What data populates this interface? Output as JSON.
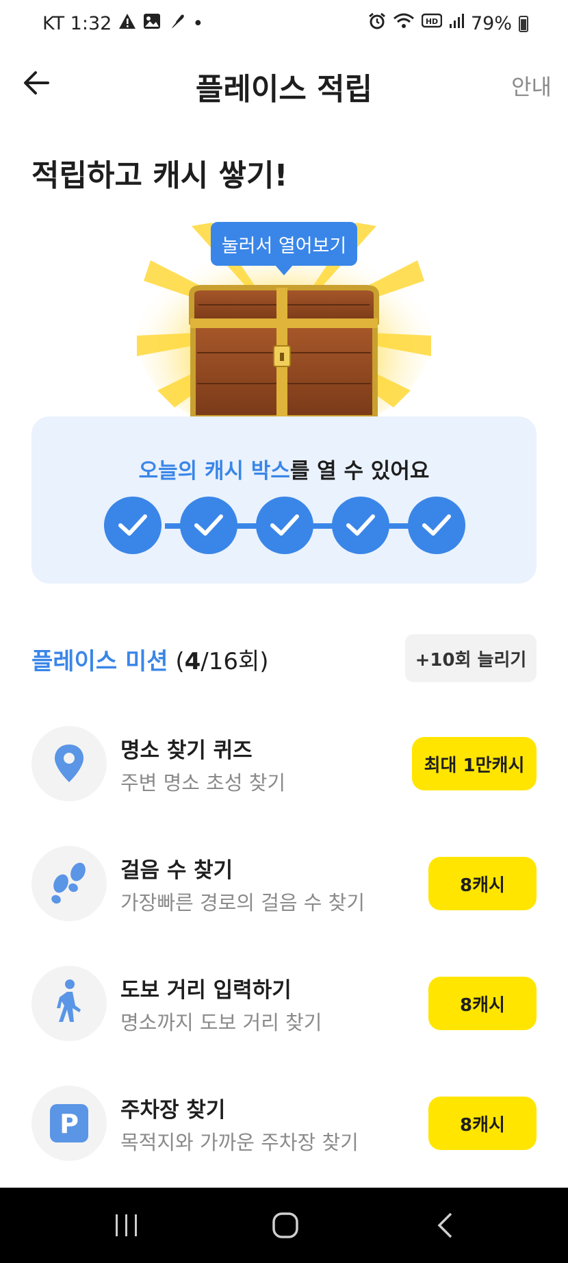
{
  "status_bar": {
    "carrier_time": "KT 1:32",
    "dot": "•",
    "battery": "79%"
  },
  "header": {
    "title": "플레이스 적립",
    "guide": "안내"
  },
  "headline": "적립하고 캐시 쌓기!",
  "chest": {
    "tooltip": "눌러서 열어보기"
  },
  "cash_box": {
    "text_highlight": "오늘의 캐시 박스",
    "text_rest": "를 열 수 있어요",
    "checks_completed": 5,
    "checks_total": 5
  },
  "missions": {
    "title": "플레이스 미션",
    "count_open": " (",
    "count_done": "4",
    "count_rest": "/16회)",
    "increase_button": "+10회 늘리기",
    "items": [
      {
        "title": "명소 찾기 퀴즈",
        "subtitle": "주변 명소 초성 찾기",
        "reward": "최대 1만캐시",
        "icon": "location-pin-icon"
      },
      {
        "title": "걸음 수 찾기",
        "subtitle": "가장빠른 경로의 걸음 수 찾기",
        "reward": "8캐시",
        "icon": "footprints-icon"
      },
      {
        "title": "도보 거리 입력하기",
        "subtitle": "명소까지 도보 거리 찾기",
        "reward": "8캐시",
        "icon": "walking-person-icon"
      },
      {
        "title": "주차장 찾기",
        "subtitle": "목적지와 가까운 주차장 찾기",
        "reward": "8캐시",
        "icon": "parking-icon"
      }
    ]
  },
  "colors": {
    "accent": "#3a86e8",
    "reward": "#ffe500",
    "card_bg": "#eaf2fd"
  }
}
